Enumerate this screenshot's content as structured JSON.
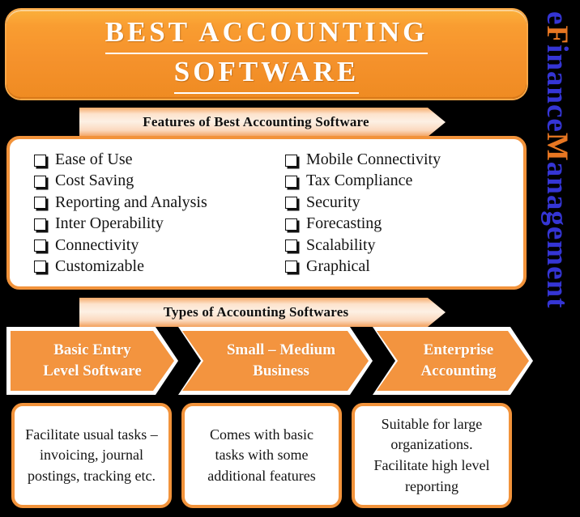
{
  "title": {
    "line1": "BEST ACCOUNTING",
    "line2": "SOFTWARE"
  },
  "brand": {
    "e": "e",
    "F": "F",
    "inance": "inance",
    "M": "M",
    "anagement": "anagement",
    "full": "eFinanceManagement",
    "blue": "#3535d4",
    "orange": "#e87722"
  },
  "features": {
    "heading": "Features of Best Accounting Software",
    "left_column": [
      "Ease of Use",
      "Cost Saving",
      "Reporting and Analysis",
      "Inter Operability",
      "Connectivity",
      "Customizable"
    ],
    "right_column": [
      "Mobile Connectivity",
      "Tax Compliance",
      "Security",
      "Forecasting",
      "Scalability",
      "Graphical"
    ]
  },
  "types": {
    "heading": "Types of Accounting Softwares",
    "stages": [
      {
        "label": "Basic Entry\nLevel Software",
        "label_line1": "Basic Entry",
        "label_line2": "Level Software",
        "description": "Facilitate usual tasks – invoicing, journal postings, tracking etc."
      },
      {
        "label": "Small – Medium\nBusiness",
        "label_line1": "Small – Medium",
        "label_line2": "Business",
        "description": "Comes with basic tasks with some additional features"
      },
      {
        "label": "Enterprise\nAccounting",
        "label_line1": "Enterprise",
        "label_line2": "Accounting",
        "description": "Suitable for large organizations. Facilitate high level reporting"
      }
    ]
  },
  "colors": {
    "background": "#000000",
    "orange_accent": "#f2933b",
    "orange_banner_top": "#fbb03b",
    "orange_banner_bottom": "#ef8b22",
    "peach_light": "#fdf0e4",
    "peach_edge": "#f2a05c",
    "card_white": "#ffffff",
    "text_dark": "#141414"
  }
}
